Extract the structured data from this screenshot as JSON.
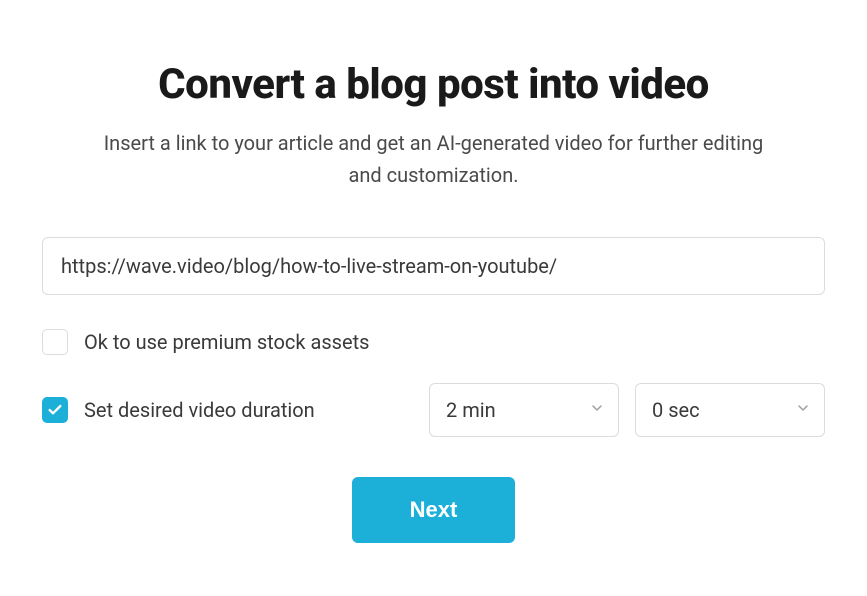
{
  "title": "Convert a blog post into video",
  "subtitle": "Insert a link to your article and get an AI-generated video for further editing and customization.",
  "url_input": {
    "value": "https://wave.video/blog/how-to-live-stream-on-youtube/"
  },
  "premium_assets": {
    "label": "Ok to use premium stock assets",
    "checked": false
  },
  "duration": {
    "label": "Set desired video duration",
    "checked": true,
    "minutes_selected": "2 min",
    "seconds_selected": "0 sec"
  },
  "next_button": "Next",
  "colors": {
    "accent": "#1cb0d9"
  }
}
